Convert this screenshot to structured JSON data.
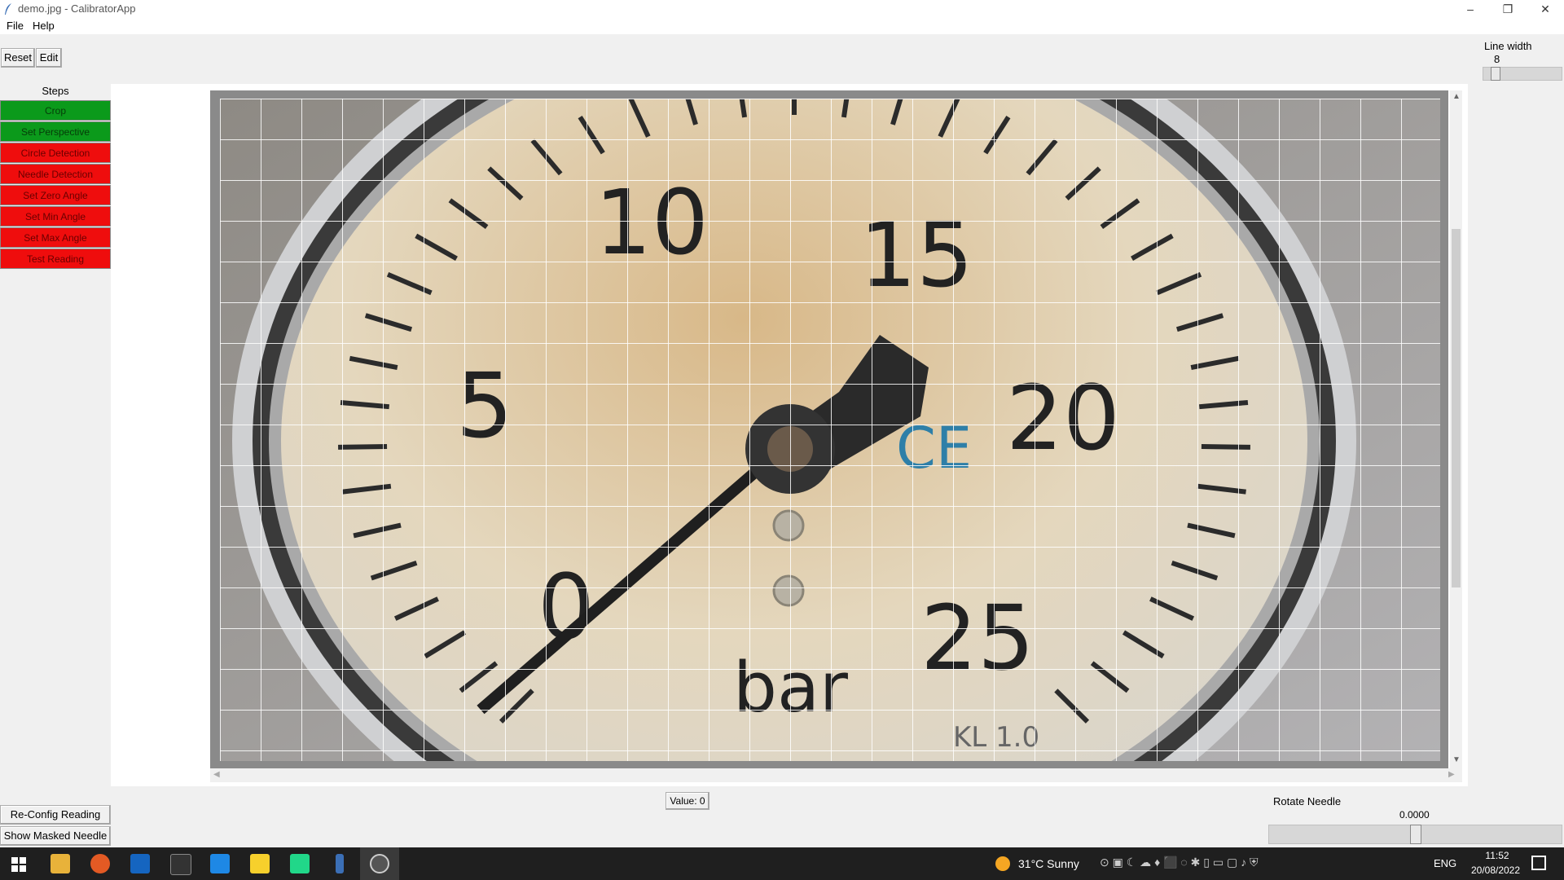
{
  "window": {
    "title": "demo.jpg - CalibratorApp",
    "minimize_glyph": "–",
    "restore_glyph": "❐",
    "close_glyph": "✕"
  },
  "menu": {
    "file": "File",
    "help": "Help"
  },
  "toolbar": {
    "reset_label": "Reset",
    "edit_label": "Edit"
  },
  "line_width": {
    "label": "Line width",
    "value": "8",
    "level": 0.1
  },
  "steps": {
    "header": "Steps",
    "items": [
      {
        "label": "Crop",
        "status": "done",
        "color": "#0b9a1b"
      },
      {
        "label": "Set Perspective",
        "status": "done",
        "color": "#0b9a1b"
      },
      {
        "label": "Circle Detection",
        "status": "pending",
        "color": "#ef0d0d"
      },
      {
        "label": "Needle Detection",
        "status": "pending",
        "color": "#ef0d0d"
      },
      {
        "label": "Set Zero Angle",
        "status": "pending",
        "color": "#ef0d0d"
      },
      {
        "label": "Set Min Angle",
        "status": "pending",
        "color": "#ef0d0d"
      },
      {
        "label": "Set Max Angle",
        "status": "pending",
        "color": "#ef0d0d"
      },
      {
        "label": "Test Reading",
        "status": "pending",
        "color": "#ef0d0d"
      }
    ]
  },
  "gauge": {
    "labels": [
      "10",
      "15",
      "5",
      "20",
      "0",
      "25"
    ],
    "unit": "bar",
    "mark": "CE",
    "class": "KL 1.0"
  },
  "bottom": {
    "reconfig_label": "Re-Config Reading",
    "show_masked_label": "Show Masked Needle",
    "value_label": "Value: 0",
    "rotate_label": "Rotate Needle",
    "rotate_value": "0.0000",
    "rotate_level": 0.5
  },
  "taskbar": {
    "weather": "31°C  Sunny",
    "lang": "ENG",
    "time": "11:52",
    "date": "20/08/2022",
    "icons": [
      "windows-start-icon",
      "file-explorer-icon",
      "firefox-icon",
      "outlook-icon",
      "terminal-icon",
      "vscode-icon",
      "sticky-notes-icon",
      "pycharm-icon",
      "feather-app-icon",
      "python-app-icon"
    ]
  }
}
